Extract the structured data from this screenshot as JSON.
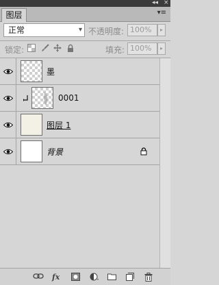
{
  "window": {
    "collapse_glyph": "◂◂",
    "close_glyph": "×"
  },
  "panel": {
    "tab_label": "图层",
    "menu_glyph": "▾≡"
  },
  "blend_mode": {
    "value": "正常",
    "arrow": "▾"
  },
  "opacity": {
    "label": "不透明度:",
    "value": "100%",
    "flyout": "▸"
  },
  "lock": {
    "label": "锁定:"
  },
  "fill": {
    "label": "填充:",
    "value": "100%",
    "flyout": "▸"
  },
  "layers": [
    {
      "name": "墨",
      "visible": true,
      "thumbnail": "transparent",
      "clipped": false,
      "locked": false
    },
    {
      "name": "0001",
      "visible": true,
      "thumbnail": "transparent-with-content",
      "clipped": true,
      "locked": false
    },
    {
      "name": "图层 1",
      "visible": true,
      "thumbnail": "pale-fill",
      "clipped": false,
      "locked": false,
      "underline": true
    },
    {
      "name": "背景",
      "visible": true,
      "thumbnail": "white",
      "clipped": false,
      "locked": true,
      "italic": true
    }
  ],
  "bottom_toolbar": {
    "fx_label": "fx"
  },
  "colors": {
    "panel_bg": "#d6d6d6",
    "title_bar": "#3b3b3b",
    "tab_bar": "#b9b9b9",
    "divider": "#a4a4a4"
  }
}
